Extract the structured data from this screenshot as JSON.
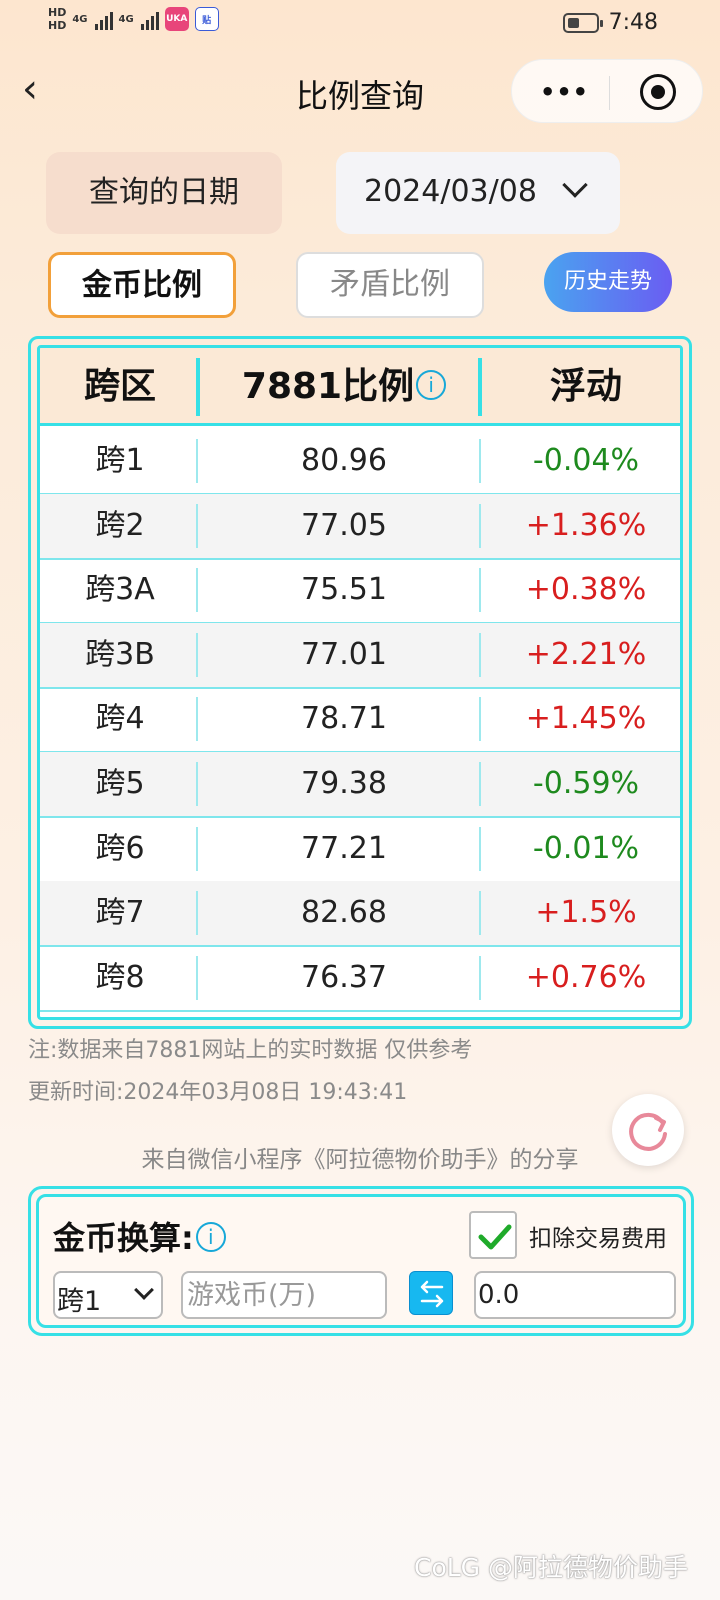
{
  "status_bar": {
    "hd1": "HD",
    "hd2": "HD",
    "net1": "4G",
    "net2": "4G",
    "app1": "UKA",
    "app2": "贴",
    "time": "7:48"
  },
  "nav": {
    "title": "比例查询",
    "more": "•••"
  },
  "date": {
    "label": "查询的日期",
    "value": "2024/03/08"
  },
  "tabs": [
    {
      "label": "金币比例",
      "active": true
    },
    {
      "label": "矛盾比例",
      "active": false
    }
  ],
  "history_button": "历史走势",
  "table": {
    "headers": [
      "跨区",
      "7881比例",
      "浮动"
    ],
    "info_icon": "i",
    "rows": [
      {
        "zone": "跨1",
        "ratio": "80.96",
        "change": "-0.04%",
        "trend": "down"
      },
      {
        "zone": "跨2",
        "ratio": "77.05",
        "change": "+1.36%",
        "trend": "up"
      },
      {
        "zone": "跨3A",
        "ratio": "75.51",
        "change": "+0.38%",
        "trend": "up"
      },
      {
        "zone": "跨3B",
        "ratio": "77.01",
        "change": "+2.21%",
        "trend": "up"
      },
      {
        "zone": "跨4",
        "ratio": "78.71",
        "change": "+1.45%",
        "trend": "up"
      },
      {
        "zone": "跨5",
        "ratio": "79.38",
        "change": "-0.59%",
        "trend": "down"
      },
      {
        "zone": "跨6",
        "ratio": "77.21",
        "change": "-0.01%",
        "trend": "down"
      },
      {
        "zone": "跨7",
        "ratio": "82.68",
        "change": "+1.5%",
        "trend": "up"
      },
      {
        "zone": "跨8",
        "ratio": "76.37",
        "change": "+0.76%",
        "trend": "up"
      }
    ]
  },
  "notes": {
    "source": "注:数据来自7881网站上的实时数据 仅供参考",
    "updated": "更新时间:2024年03月08日 19:43:41",
    "share": "来自微信小程序《阿拉德物价助手》的分享"
  },
  "converter": {
    "title": "金币换算:",
    "info_icon": "i",
    "fee_label": "扣除交易费用",
    "fee_checked": true,
    "server": "跨1",
    "input_placeholder": "游戏币(万)",
    "result": "0.0"
  },
  "watermark": "CoLG @阿拉德物价助手",
  "colors": {
    "accent_cyan": "#36e0e6",
    "up_red": "#d81e1e",
    "down_green": "#1e8a1e",
    "tab_orange": "#f2a03a"
  }
}
